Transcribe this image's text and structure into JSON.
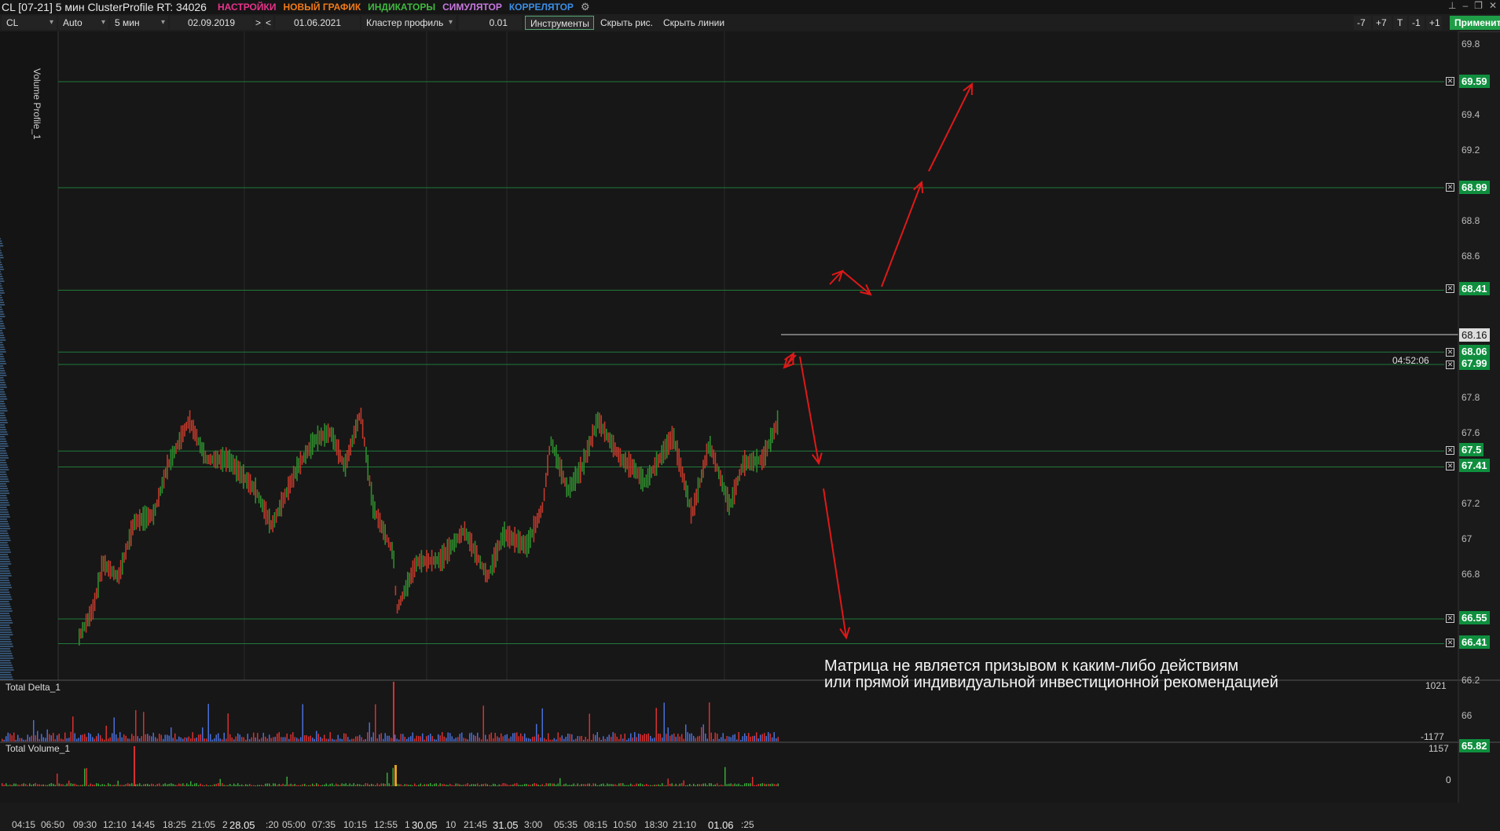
{
  "title_bar": {
    "title": "CL [07-21] 5 мин ClusterProfile RT: 34026",
    "menus": [
      {
        "label": "НАСТРОЙКИ",
        "color": "#e8338a"
      },
      {
        "label": "НОВЫЙ ГРАФИК",
        "color": "#f07a1a"
      },
      {
        "label": "ИНДИКАТОРЫ",
        "color": "#3fb93f"
      },
      {
        "label": "СИМУЛЯТОР",
        "color": "#c879e0"
      },
      {
        "label": "КОРРЕЛЯТОР",
        "color": "#3b8ee6"
      }
    ],
    "settings_icon": "gears-icon"
  },
  "toolbar": {
    "symbol": "CL",
    "scale": "Auto",
    "timeframe": "5 мин",
    "date_from": "02.09.2019",
    "nav_next": ">",
    "nav_prev": "<",
    "date_to": "01.06.2021",
    "chart_type": "Кластер профиль",
    "step": "0.01",
    "tools_label": "Инструменты",
    "hide_drawings": "Скрыть рис.",
    "hide_lines": "Скрыть линии",
    "minus7": "-7",
    "plus7": "+7",
    "t_label": "T",
    "minus1": "-1",
    "plus1": "+1",
    "apply": "Применить"
  },
  "chart": {
    "volume_profile_label": "Volume Profile_1",
    "annotation_line1": "Матрица не является призывом к каким-либо действиям",
    "annotation_line2": "или прямой индивидуальной инвестиционной рекомендацией",
    "timer": "04:52:06",
    "current_price": "68.16",
    "price_axis": [
      "69.8",
      "69.4",
      "69.2",
      "68.8",
      "68.6",
      "67.8",
      "67.6",
      "67.2",
      "67",
      "66.8",
      "66.2",
      "66"
    ],
    "levels": [
      "69.59",
      "68.99",
      "68.41",
      "68.06",
      "67.99",
      "67.5",
      "67.41",
      "66.55",
      "66.41"
    ],
    "delta_panel": {
      "title": "Total Delta_1",
      "max": "1021",
      "min": "-1177",
      "level": "65.82"
    },
    "volume_panel": {
      "title": "Total Volume_1",
      "max": "1157",
      "min": "0"
    },
    "time_labels": [
      "04:15",
      "06:50",
      "09:30",
      "12:10",
      "14:45",
      "18:25",
      "21:05",
      "2",
      "28.05",
      ":20",
      "05:00",
      "07:35",
      "10:15",
      "12:55",
      "1",
      "30.05",
      "10",
      "21:45",
      "31.05",
      "3:00",
      "05:35",
      "08:15",
      "10:50",
      "18:30",
      "21:10",
      "01.06",
      ":25"
    ],
    "colors": {
      "level_line": "#1f7a3a",
      "level_label": "#0f8f3e",
      "arrow": "#e01818",
      "bull": "#2e8b2e",
      "bear": "#c0392b"
    }
  }
}
